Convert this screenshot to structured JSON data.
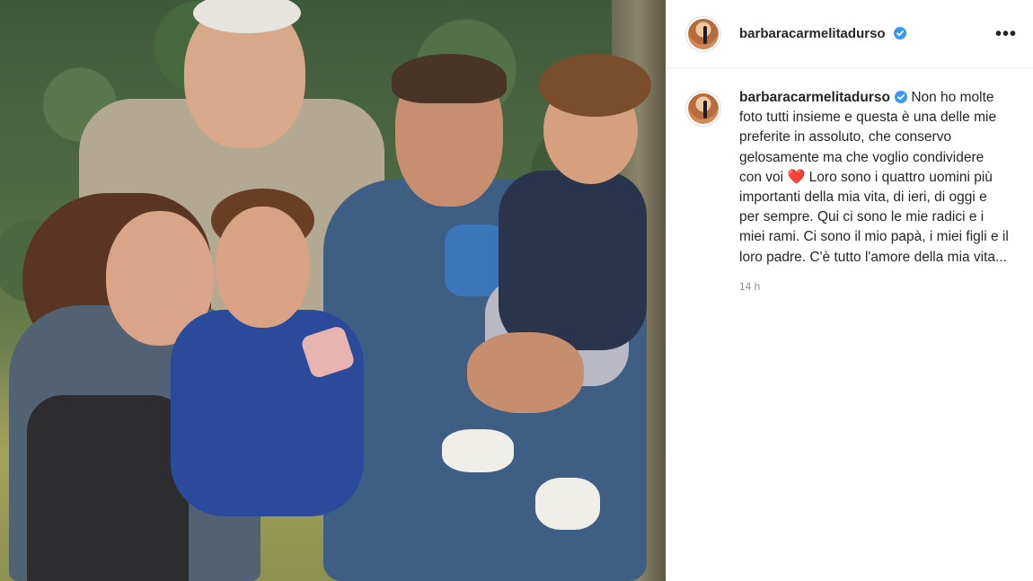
{
  "post": {
    "username": "barbaracarmelitadurso",
    "verified": true,
    "more_label": "•••",
    "caption_username": "barbaracarmelitadurso",
    "caption_part1": "Non ho molte foto tutti insieme e questa è una delle mie preferite in assoluto, che conservo gelosamente ma che voglio condividere con voi",
    "caption_emoji": "❤️",
    "caption_part2": "Loro sono i quattro uomini più importanti della mia vita, di ieri, di oggi e per sempre. Qui ci sono le mie radici e i miei rami. Ci sono il mio papà, i miei figli e il loro padre. C'è tutto l'amore della mia vita...",
    "timestamp": "14 h"
  },
  "colors": {
    "verified_badge": "#3897f0",
    "heart": "#e0142c",
    "text": "#262626",
    "muted": "#8e8e8e",
    "divider": "#efefef"
  },
  "icons": {
    "verified": "verified-badge-icon",
    "more": "more-options-icon"
  }
}
